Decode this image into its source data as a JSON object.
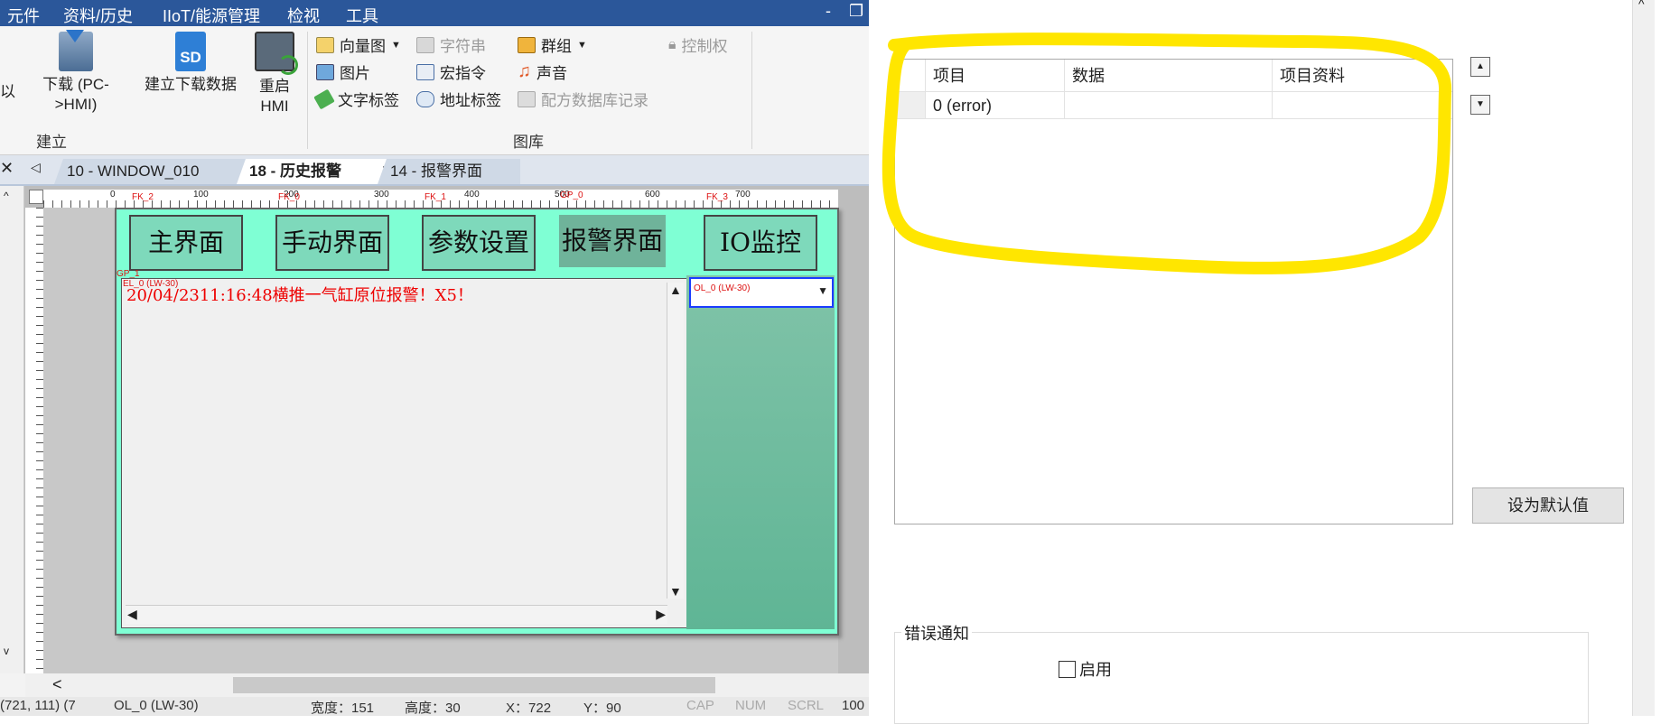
{
  "menubar": {
    "items": [
      "元件",
      "资料/历史",
      "IIoT/能源管理",
      "检视",
      "工具"
    ],
    "controls": [
      "-",
      "❐"
    ]
  },
  "ribbon": {
    "left_partial_label": "以",
    "download_label": "下载 (PC->HMI)",
    "build_download_label": "建立下载数据",
    "restart_label": "重启 HMI",
    "build_group_label": "建立",
    "vector_label": "向量图",
    "string_label": "字符串",
    "group_label": "群组",
    "control_label": "控制权",
    "picture_label": "图片",
    "macro_label": "宏指令",
    "sound_label": "声音",
    "text_tag_label": "文字标签",
    "address_tag_label": "地址标签",
    "recipe_label": "配方数据库记录",
    "library_group_label": "图库"
  },
  "tabs": [
    {
      "label": "10 - WINDOW_010"
    },
    {
      "label": "18 - 历史报警",
      "close": "✕"
    },
    {
      "label": "14 - 报警界面"
    }
  ],
  "screen": {
    "nav_buttons": [
      {
        "label": "主界面",
        "tag": "FK_2"
      },
      {
        "label": "手动界面",
        "tag": "FK_0"
      },
      {
        "label": "参数设置",
        "tag": "FK_1"
      },
      {
        "label": "报警界面",
        "tag": "GP_0"
      },
      {
        "label": "IO监控",
        "tag": "FK_3"
      }
    ],
    "alarm_tag": "EL_0 (LW-30)",
    "gp_tag": "GP_1",
    "alarm_text": "20/04/2311:16:48横推一气缸原位报警！X5！",
    "option_list_tag": "OL_0 (LW-30)"
  },
  "ruler_marks": [
    "0",
    "100",
    "200",
    "300",
    "400",
    "500",
    "600",
    "700"
  ],
  "statusbar": {
    "items": [
      "(721, 111) (7",
      "OL_0 (LW-30)",
      "宽度：151",
      "高度：30",
      "X：722",
      "Y：90",
      "CAP",
      "NUM",
      "SCRL",
      "100"
    ]
  },
  "dialog": {
    "grid_headers": [
      "项目",
      "数据",
      "项目资料"
    ],
    "grid_row": [
      "0 (error)",
      "",
      ""
    ],
    "up_icon": "▲",
    "down_icon": "▼",
    "default_button": "设为默认值",
    "error_section_title": "错误通知",
    "enable_label": "启用",
    "highlight_color": "#ffe600"
  }
}
